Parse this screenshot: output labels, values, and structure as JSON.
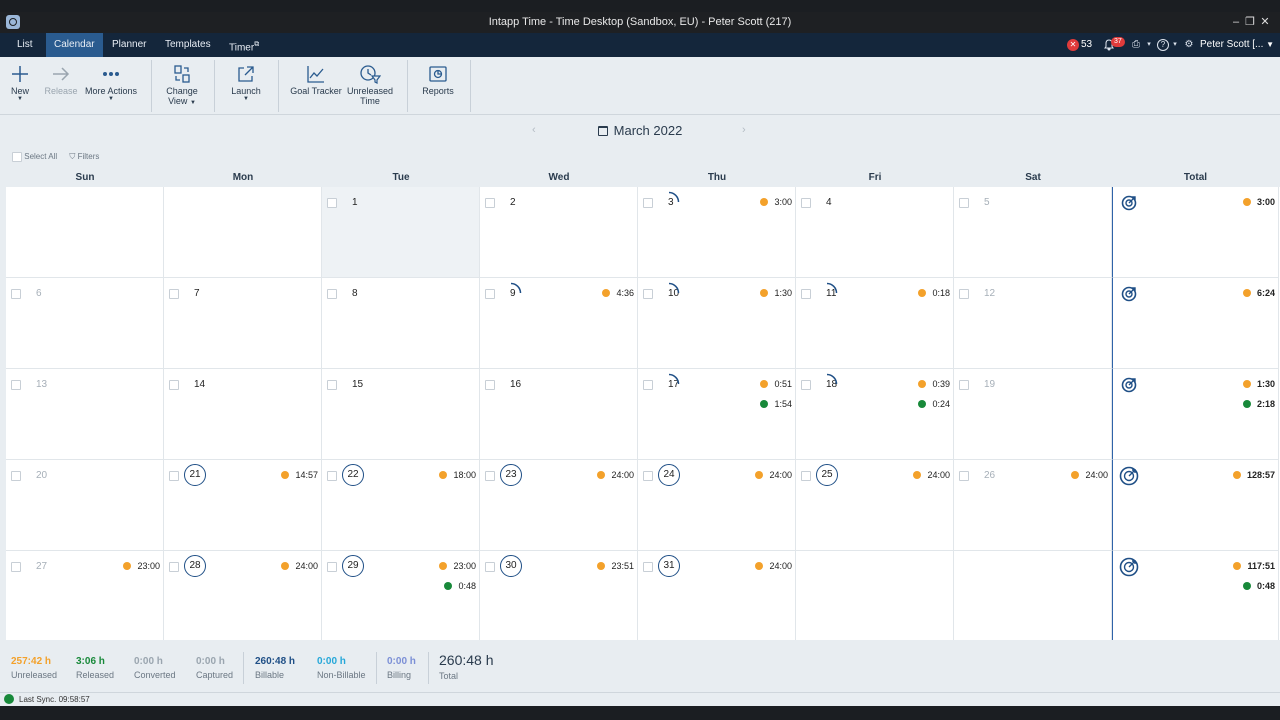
{
  "window": {
    "title": "Intapp Time - Time Desktop (Sandbox, EU) - Peter Scott (217)"
  },
  "nav": {
    "tabs": [
      "List",
      "Calendar",
      "Planner",
      "Templates",
      "Timer"
    ],
    "active_tab": "Calendar",
    "error_count": "53",
    "notification_count": "37",
    "user": "Peter Scott [..."
  },
  "toolbar": {
    "new": "New",
    "release": "Release",
    "more_actions": "More Actions",
    "change_view_1": "Change",
    "change_view_2": "View",
    "launch": "Launch",
    "goal_tracker": "Goal Tracker",
    "unreleased_1": "Unreleased",
    "unreleased_2": "Time",
    "reports": "Reports"
  },
  "calendar": {
    "month": "March 2022",
    "select_all": "Select All",
    "filters": "Filters",
    "days_of_week": [
      "Sun",
      "Mon",
      "Tue",
      "Wed",
      "Thu",
      "Fri",
      "Sat",
      "Total"
    ],
    "weeks": [
      [
        {
          "day": "",
          "entries": []
        },
        {
          "day": "",
          "entries": []
        },
        {
          "day": "1",
          "entries": []
        },
        {
          "day": "2",
          "entries": []
        },
        {
          "day": "3",
          "entries": [
            {
              "c": "orange",
              "t": "3:00"
            }
          ]
        },
        {
          "day": "4",
          "entries": []
        },
        {
          "day": "5",
          "entries": []
        },
        {
          "day": "",
          "entries": [
            {
              "c": "orange",
              "t": "3:00"
            }
          ]
        }
      ],
      [
        {
          "day": "6",
          "entries": []
        },
        {
          "day": "7",
          "entries": []
        },
        {
          "day": "8",
          "entries": []
        },
        {
          "day": "9",
          "entries": [
            {
              "c": "orange",
              "t": "4:36"
            }
          ]
        },
        {
          "day": "10",
          "entries": [
            {
              "c": "orange",
              "t": "1:30"
            }
          ]
        },
        {
          "day": "11",
          "entries": [
            {
              "c": "orange",
              "t": "0:18"
            }
          ]
        },
        {
          "day": "12",
          "entries": []
        },
        {
          "day": "",
          "entries": [
            {
              "c": "orange",
              "t": "6:24"
            }
          ]
        }
      ],
      [
        {
          "day": "13",
          "entries": []
        },
        {
          "day": "14",
          "entries": []
        },
        {
          "day": "15",
          "entries": []
        },
        {
          "day": "16",
          "entries": []
        },
        {
          "day": "17",
          "entries": [
            {
              "c": "orange",
              "t": "0:51"
            },
            {
              "c": "green",
              "t": "1:54"
            }
          ]
        },
        {
          "day": "18",
          "entries": [
            {
              "c": "orange",
              "t": "0:39"
            },
            {
              "c": "green",
              "t": "0:24"
            }
          ]
        },
        {
          "day": "19",
          "entries": []
        },
        {
          "day": "",
          "entries": [
            {
              "c": "orange",
              "t": "1:30"
            },
            {
              "c": "green",
              "t": "2:18"
            }
          ]
        }
      ],
      [
        {
          "day": "20",
          "entries": []
        },
        {
          "day": "21",
          "entries": [
            {
              "c": "orange",
              "t": "14:57"
            }
          ]
        },
        {
          "day": "22",
          "entries": [
            {
              "c": "orange",
              "t": "18:00"
            }
          ]
        },
        {
          "day": "23",
          "entries": [
            {
              "c": "orange",
              "t": "24:00"
            }
          ]
        },
        {
          "day": "24",
          "entries": [
            {
              "c": "orange",
              "t": "24:00"
            }
          ]
        },
        {
          "day": "25",
          "entries": [
            {
              "c": "orange",
              "t": "24:00"
            }
          ]
        },
        {
          "day": "26",
          "entries": [
            {
              "c": "orange",
              "t": "24:00"
            }
          ]
        },
        {
          "day": "",
          "entries": [
            {
              "c": "orange",
              "t": "128:57"
            }
          ]
        }
      ],
      [
        {
          "day": "27",
          "entries": [
            {
              "c": "orange",
              "t": "23:00"
            }
          ]
        },
        {
          "day": "28",
          "entries": [
            {
              "c": "orange",
              "t": "24:00"
            }
          ]
        },
        {
          "day": "29",
          "entries": [
            {
              "c": "orange",
              "t": "23:00"
            },
            {
              "c": "green",
              "t": "0:48"
            }
          ]
        },
        {
          "day": "30",
          "entries": [
            {
              "c": "orange",
              "t": "23:51"
            }
          ]
        },
        {
          "day": "31",
          "entries": [
            {
              "c": "orange",
              "t": "24:00"
            }
          ]
        },
        {
          "day": "",
          "entries": []
        },
        {
          "day": "",
          "entries": []
        },
        {
          "day": "",
          "entries": [
            {
              "c": "orange",
              "t": "117:51"
            },
            {
              "c": "green",
              "t": "0:48"
            }
          ]
        }
      ]
    ]
  },
  "summary": {
    "unreleased": {
      "value": "257:42 h",
      "label": "Unreleased",
      "color": "#f3a12b"
    },
    "released": {
      "value": "3:06 h",
      "label": "Released",
      "color": "#18893a"
    },
    "converted": {
      "value": "0:00 h",
      "label": "Converted",
      "color": "#9aa5af"
    },
    "captured": {
      "value": "0:00 h",
      "label": "Captured",
      "color": "#9aa5af"
    },
    "billable": {
      "value": "260:48 h",
      "label": "Billable",
      "color": "#1f4f86"
    },
    "non_billable": {
      "value": "0:00 h",
      "label": "Non-Billable",
      "color": "#25a7d9"
    },
    "billing": {
      "value": "0:00 h",
      "label": "Billing",
      "color": "#7b8fd6"
    },
    "total": {
      "value": "260:48 h",
      "label": "Total"
    }
  },
  "status": {
    "last_sync": "Last Sync. 09:58:57"
  },
  "colors": {
    "accent": "#2a5b8f",
    "navbar": "#14263b",
    "unreleased": "#f3a12b",
    "released": "#18893a"
  }
}
